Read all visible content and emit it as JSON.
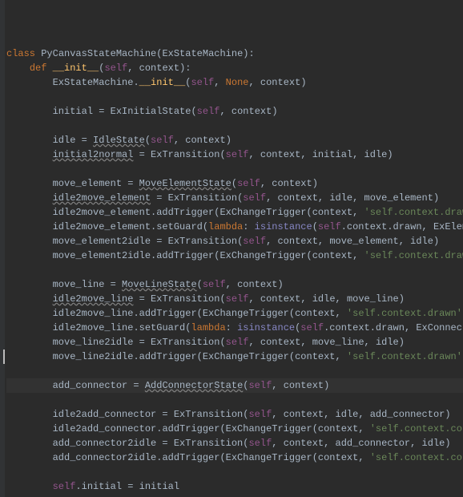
{
  "code": {
    "class_kw": "class",
    "class_name": "PyCanvasStateMachine",
    "extends": "ExStateMachine",
    "def_kw": "def",
    "init_name": "__init__",
    "self": "self",
    "context": "context",
    "None": "None",
    "super_call_cls": "ExStateMachine",
    "initial_var": "initial",
    "ExInitialState": "ExInitialState",
    "idle_var": "idle",
    "IdleState": "IdleState",
    "initial2normal": "initial2normal",
    "ExTransition": "ExTransition",
    "move_element_var": "move_element",
    "MoveElementState": "MoveElementState",
    "idle2move_element": "idle2move_element",
    "addTrigger": "addTrigger",
    "ExChangeTrigger": "ExChangeTrigger",
    "str_drawn": "'self.context.drawn'",
    "setGuard": "setGuard",
    "lambda_kw": "lambda",
    "isinstance": "isinstance",
    "context_drawn": ".context.drawn",
    "ExElement": "ExElement",
    "move_element2idle": "move_element2idle",
    "move_line_var": "move_line",
    "MoveLineState": "MoveLineState",
    "idle2move_line": "idle2move_line",
    "ExConnector": "ExConnector",
    "move_line2idle": "move_line2idle",
    "add_connector_var": "add_connector",
    "AddConnectorState": "AddConnectorState",
    "idle2add_connector": "idle2add_connector",
    "str_connector": "'self.context.connector'",
    "add_connector2idle": "add_connector2idle",
    "self_initial": ".initial"
  },
  "chart_data": null
}
